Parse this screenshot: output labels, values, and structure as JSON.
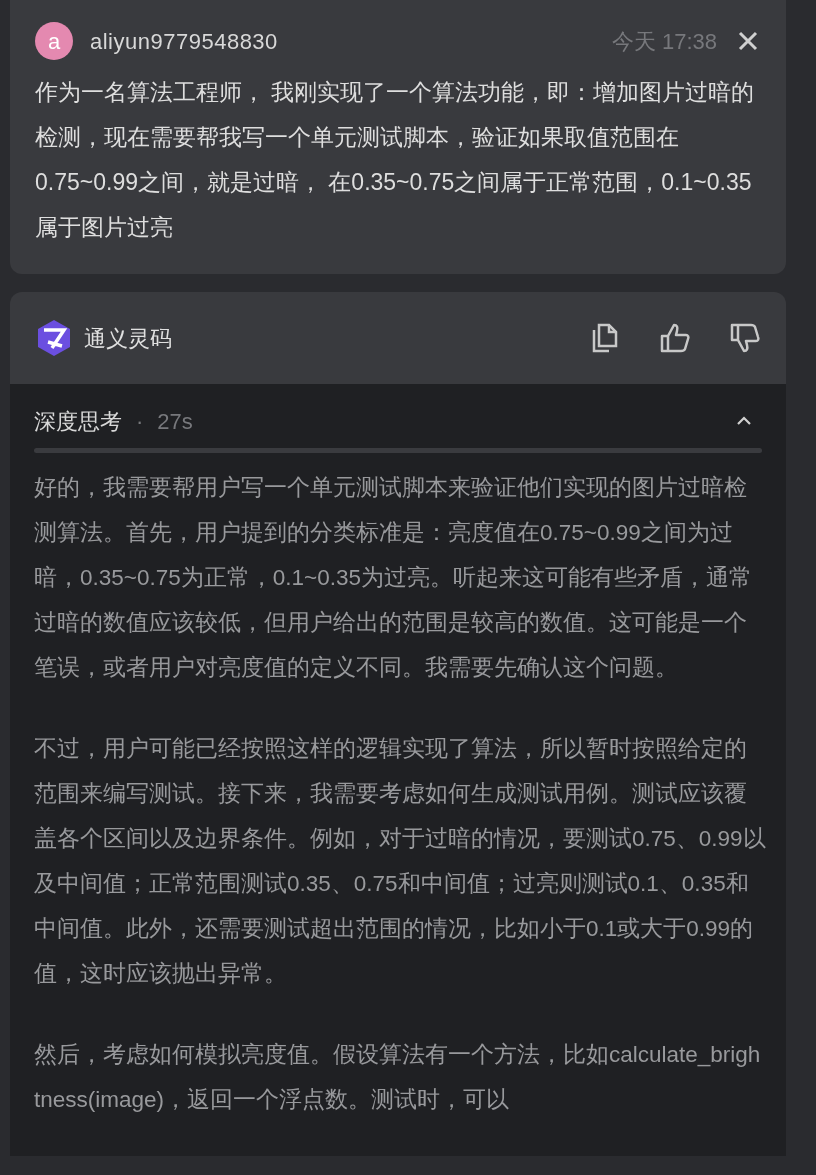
{
  "user_message": {
    "avatar": "a",
    "username": "aliyun9779548830",
    "time": "今天 17:38",
    "text": "作为一名算法工程师， 我刚实现了一个算法功能，即：增加图片过暗的检测，现在需要帮我写一个单元测试脚本，验证如果取值范围在0.75~0.99之间，就是过暗， 在0.35~0.75之间属于正常范围，0.1~0.35 属于图片过亮"
  },
  "assistant": {
    "name": "通义灵码",
    "thinking": {
      "title": "深度思考",
      "separator": "·",
      "duration": "27s",
      "expanded": true,
      "paragraphs": [
        "好的，我需要帮用户写一个单元测试脚本来验证他们实现的图片过暗检测算法。首先，用户提到的分类标准是：亮度值在0.75~0.99之间为过暗，0.35~0.75为正常，0.1~0.35为过亮。听起来这可能有些矛盾，通常过暗的数值应该较低，但用户给出的范围是较高的数值。这可能是一个笔误，或者用户对亮度值的定义不同。我需要先确认这个问题。",
        "不过，用户可能已经按照这样的逻辑实现了算法，所以暂时按照给定的范围来编写测试。接下来，我需要考虑如何生成测试用例。测试应该覆盖各个区间以及边界条件。例如，对于过暗的情况，要测试0.75、0.99以及中间值；正常范围测试0.35、0.75和中间值；过亮则测试0.1、0.35和中间值。此外，还需要测试超出范围的情况，比如小于0.1或大于0.99的值，这时应该抛出异常。",
        "然后，考虑如何模拟亮度值。假设算法有一个方法，比如calculate_brightness(image)，返回一个浮点数。测试时，可以"
      ]
    }
  }
}
